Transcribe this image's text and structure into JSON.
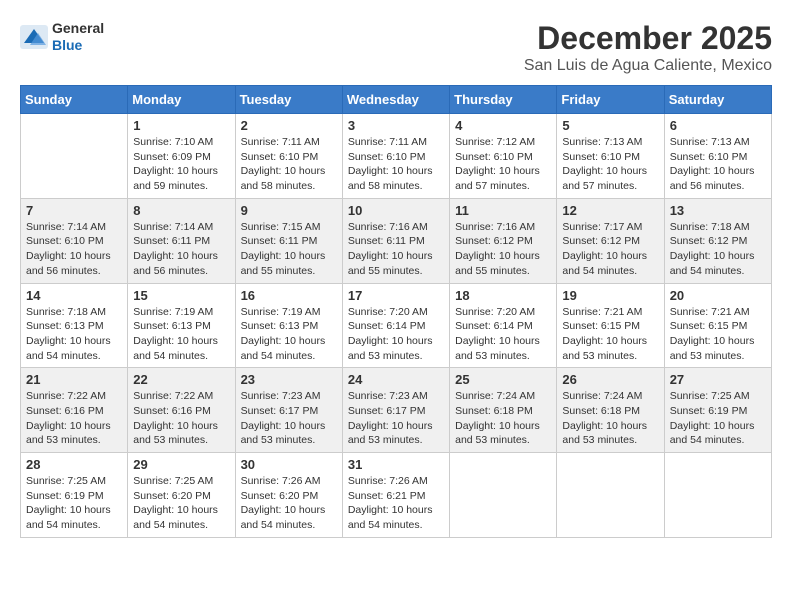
{
  "header": {
    "logo": {
      "line1": "General",
      "line2": "Blue"
    },
    "title": "December 2025",
    "location": "San Luis de Agua Caliente, Mexico"
  },
  "calendar": {
    "days_of_week": [
      "Sunday",
      "Monday",
      "Tuesday",
      "Wednesday",
      "Thursday",
      "Friday",
      "Saturday"
    ],
    "weeks": [
      [
        {
          "day": "",
          "info": ""
        },
        {
          "day": "1",
          "info": "Sunrise: 7:10 AM\nSunset: 6:09 PM\nDaylight: 10 hours\nand 59 minutes."
        },
        {
          "day": "2",
          "info": "Sunrise: 7:11 AM\nSunset: 6:10 PM\nDaylight: 10 hours\nand 58 minutes."
        },
        {
          "day": "3",
          "info": "Sunrise: 7:11 AM\nSunset: 6:10 PM\nDaylight: 10 hours\nand 58 minutes."
        },
        {
          "day": "4",
          "info": "Sunrise: 7:12 AM\nSunset: 6:10 PM\nDaylight: 10 hours\nand 57 minutes."
        },
        {
          "day": "5",
          "info": "Sunrise: 7:13 AM\nSunset: 6:10 PM\nDaylight: 10 hours\nand 57 minutes."
        },
        {
          "day": "6",
          "info": "Sunrise: 7:13 AM\nSunset: 6:10 PM\nDaylight: 10 hours\nand 56 minutes."
        }
      ],
      [
        {
          "day": "7",
          "info": "Sunrise: 7:14 AM\nSunset: 6:10 PM\nDaylight: 10 hours\nand 56 minutes."
        },
        {
          "day": "8",
          "info": "Sunrise: 7:14 AM\nSunset: 6:11 PM\nDaylight: 10 hours\nand 56 minutes."
        },
        {
          "day": "9",
          "info": "Sunrise: 7:15 AM\nSunset: 6:11 PM\nDaylight: 10 hours\nand 55 minutes."
        },
        {
          "day": "10",
          "info": "Sunrise: 7:16 AM\nSunset: 6:11 PM\nDaylight: 10 hours\nand 55 minutes."
        },
        {
          "day": "11",
          "info": "Sunrise: 7:16 AM\nSunset: 6:12 PM\nDaylight: 10 hours\nand 55 minutes."
        },
        {
          "day": "12",
          "info": "Sunrise: 7:17 AM\nSunset: 6:12 PM\nDaylight: 10 hours\nand 54 minutes."
        },
        {
          "day": "13",
          "info": "Sunrise: 7:18 AM\nSunset: 6:12 PM\nDaylight: 10 hours\nand 54 minutes."
        }
      ],
      [
        {
          "day": "14",
          "info": "Sunrise: 7:18 AM\nSunset: 6:13 PM\nDaylight: 10 hours\nand 54 minutes."
        },
        {
          "day": "15",
          "info": "Sunrise: 7:19 AM\nSunset: 6:13 PM\nDaylight: 10 hours\nand 54 minutes."
        },
        {
          "day": "16",
          "info": "Sunrise: 7:19 AM\nSunset: 6:13 PM\nDaylight: 10 hours\nand 54 minutes."
        },
        {
          "day": "17",
          "info": "Sunrise: 7:20 AM\nSunset: 6:14 PM\nDaylight: 10 hours\nand 53 minutes."
        },
        {
          "day": "18",
          "info": "Sunrise: 7:20 AM\nSunset: 6:14 PM\nDaylight: 10 hours\nand 53 minutes."
        },
        {
          "day": "19",
          "info": "Sunrise: 7:21 AM\nSunset: 6:15 PM\nDaylight: 10 hours\nand 53 minutes."
        },
        {
          "day": "20",
          "info": "Sunrise: 7:21 AM\nSunset: 6:15 PM\nDaylight: 10 hours\nand 53 minutes."
        }
      ],
      [
        {
          "day": "21",
          "info": "Sunrise: 7:22 AM\nSunset: 6:16 PM\nDaylight: 10 hours\nand 53 minutes."
        },
        {
          "day": "22",
          "info": "Sunrise: 7:22 AM\nSunset: 6:16 PM\nDaylight: 10 hours\nand 53 minutes."
        },
        {
          "day": "23",
          "info": "Sunrise: 7:23 AM\nSunset: 6:17 PM\nDaylight: 10 hours\nand 53 minutes."
        },
        {
          "day": "24",
          "info": "Sunrise: 7:23 AM\nSunset: 6:17 PM\nDaylight: 10 hours\nand 53 minutes."
        },
        {
          "day": "25",
          "info": "Sunrise: 7:24 AM\nSunset: 6:18 PM\nDaylight: 10 hours\nand 53 minutes."
        },
        {
          "day": "26",
          "info": "Sunrise: 7:24 AM\nSunset: 6:18 PM\nDaylight: 10 hours\nand 53 minutes."
        },
        {
          "day": "27",
          "info": "Sunrise: 7:25 AM\nSunset: 6:19 PM\nDaylight: 10 hours\nand 54 minutes."
        }
      ],
      [
        {
          "day": "28",
          "info": "Sunrise: 7:25 AM\nSunset: 6:19 PM\nDaylight: 10 hours\nand 54 minutes."
        },
        {
          "day": "29",
          "info": "Sunrise: 7:25 AM\nSunset: 6:20 PM\nDaylight: 10 hours\nand 54 minutes."
        },
        {
          "day": "30",
          "info": "Sunrise: 7:26 AM\nSunset: 6:20 PM\nDaylight: 10 hours\nand 54 minutes."
        },
        {
          "day": "31",
          "info": "Sunrise: 7:26 AM\nSunset: 6:21 PM\nDaylight: 10 hours\nand 54 minutes."
        },
        {
          "day": "",
          "info": ""
        },
        {
          "day": "",
          "info": ""
        },
        {
          "day": "",
          "info": ""
        }
      ]
    ]
  }
}
